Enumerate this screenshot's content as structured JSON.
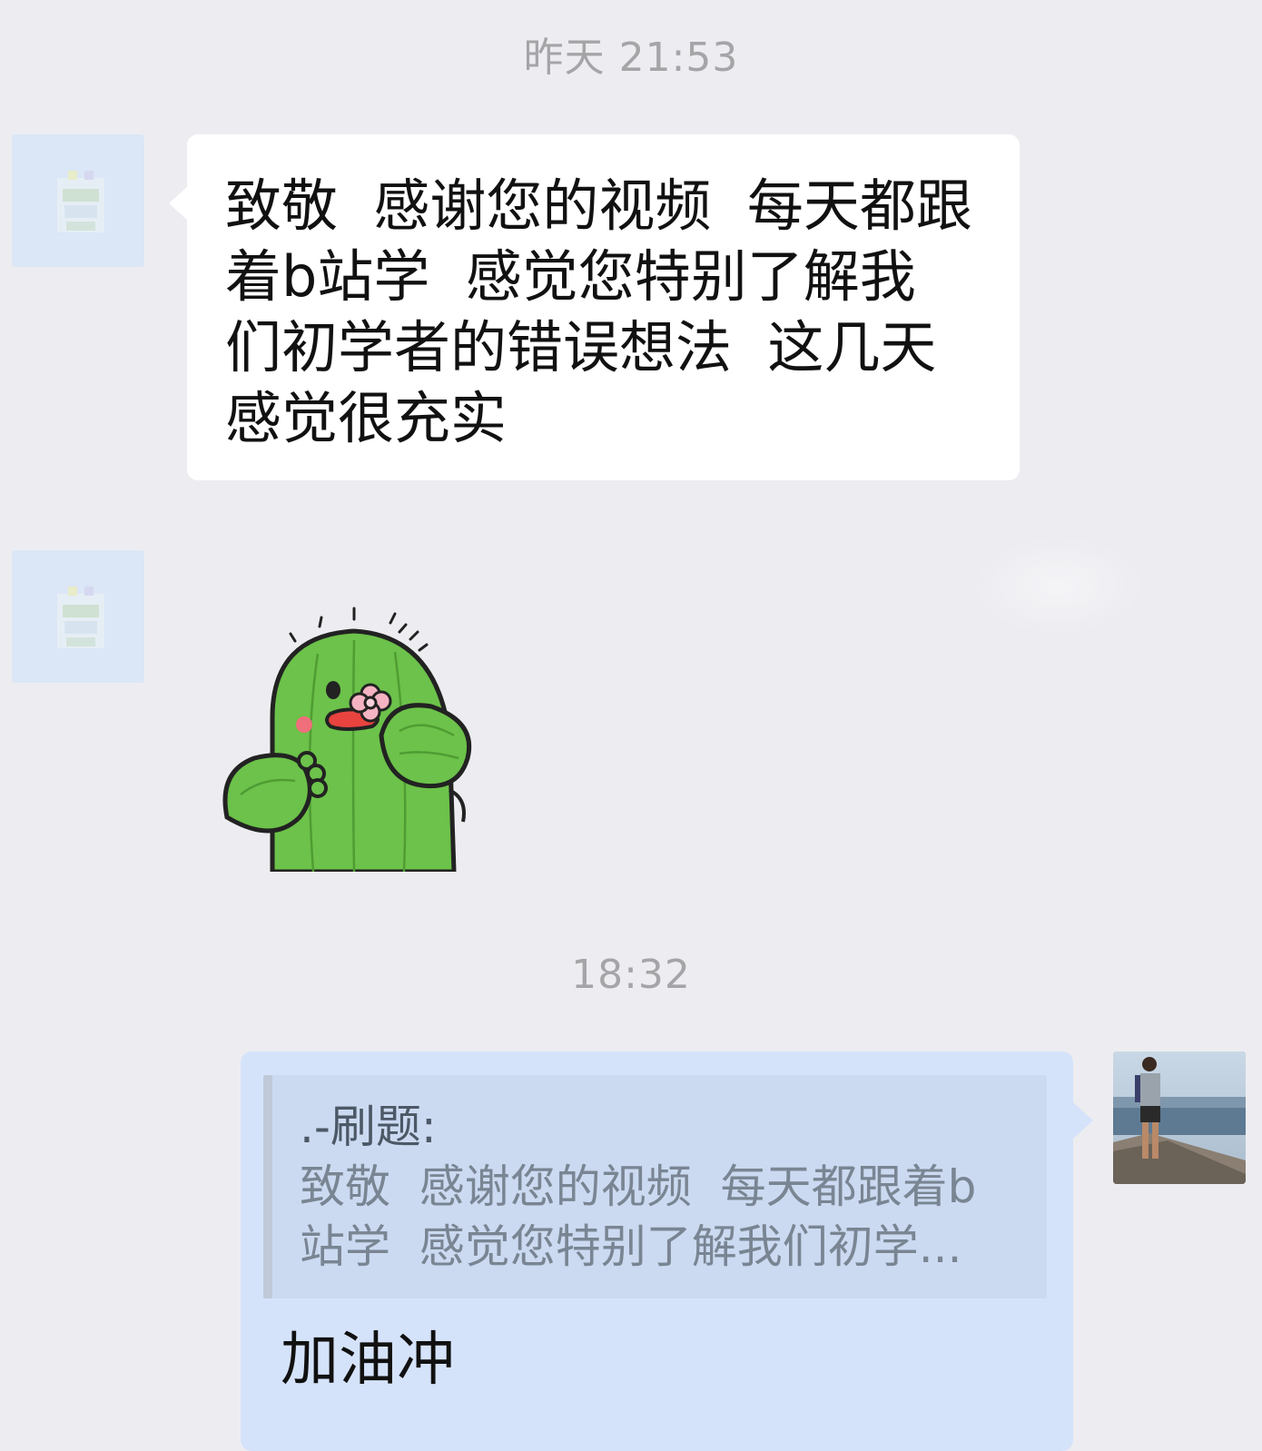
{
  "chat": {
    "timestamp_1": "昨天 21:53",
    "timestamp_2": "18:32",
    "incoming_message": "致敬  感谢您的视频  每天都跟\n着b站学  感觉您特别了解我\n们初学者的错误想法  这几天\n感觉很充实",
    "sticker": "cactus-sticker",
    "quote": {
      "author": ".-刷题:",
      "text": "致敬  感谢您的视频  每天都跟着b\n站学  感觉您特别了解我们初学..."
    },
    "reply_message": "加油冲"
  },
  "colors": {
    "background": "#ededf1",
    "incoming_bubble": "#ffffff",
    "outgoing_bubble": "#d5e3fa",
    "quote_bg": "#cbdaf1",
    "timestamp": "#a5a5a8"
  }
}
